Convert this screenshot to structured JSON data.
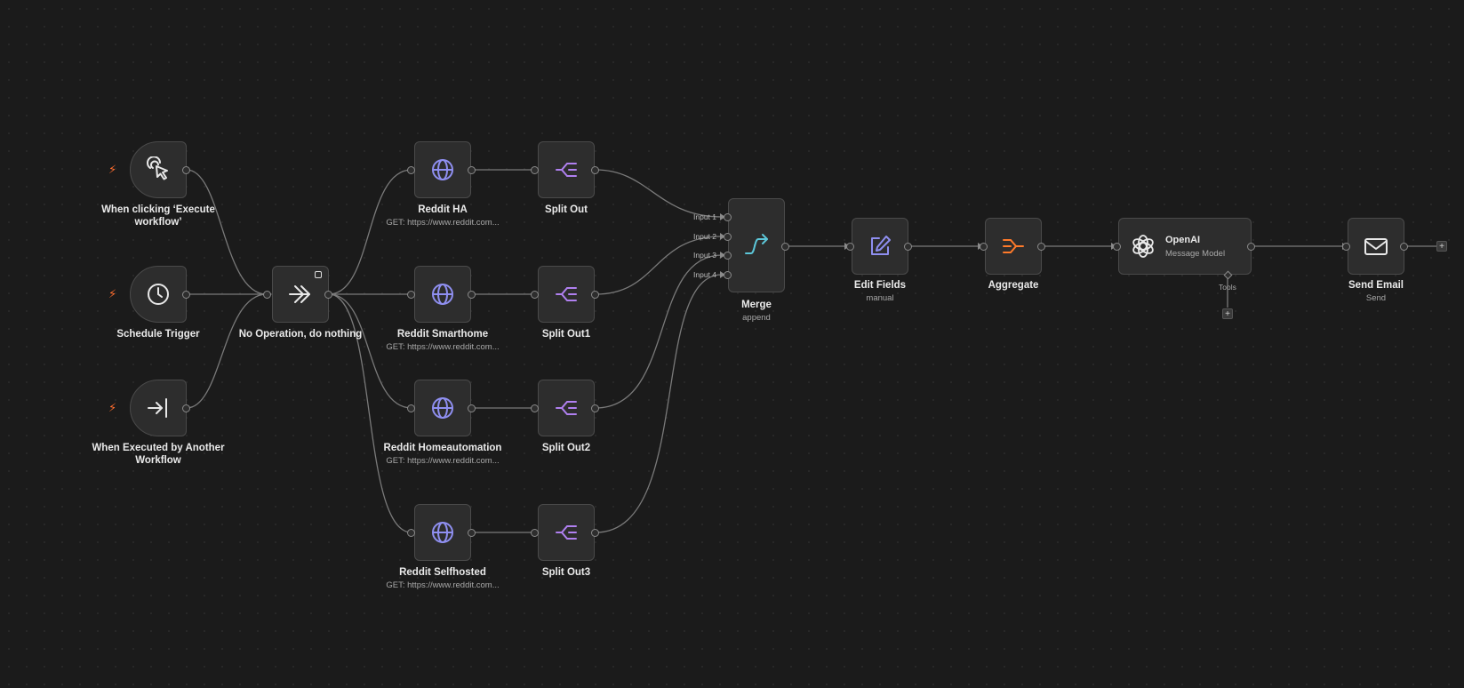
{
  "canvas": {
    "name": "workflow-canvas"
  },
  "nodes": {
    "manual_trigger": {
      "label": "When clicking ‘Execute workflow’"
    },
    "schedule_trigger": {
      "label": "Schedule Trigger"
    },
    "workflow_trigger": {
      "label": "When Executed by Another Workflow"
    },
    "noop": {
      "label": "No Operation, do nothing"
    },
    "reddit_ha": {
      "label": "Reddit HA",
      "subtitle": "GET: https://www.reddit.com..."
    },
    "reddit_smarthome": {
      "label": "Reddit Smarthome",
      "subtitle": "GET: https://www.reddit.com..."
    },
    "reddit_homeautomation": {
      "label": "Reddit Homeautomation",
      "subtitle": "GET: https://www.reddit.com..."
    },
    "reddit_selfhosted": {
      "label": "Reddit Selfhosted",
      "subtitle": "GET: https://www.reddit.com..."
    },
    "split_out": {
      "label": "Split Out"
    },
    "split_out1": {
      "label": "Split Out1"
    },
    "split_out2": {
      "label": "Split Out2"
    },
    "split_out3": {
      "label": "Split Out3"
    },
    "merge": {
      "label": "Merge",
      "subtitle": "append",
      "inputs": [
        "Input 1",
        "Input 2",
        "Input 3",
        "Input 4"
      ]
    },
    "edit_fields": {
      "label": "Edit Fields",
      "subtitle": "manual"
    },
    "aggregate": {
      "label": "Aggregate"
    },
    "openai": {
      "title": "OpenAI",
      "subtitle": "Message Model",
      "tools_label": "Tools"
    },
    "send_email": {
      "label": "Send Email",
      "subtitle": "Send"
    }
  },
  "icons": {
    "trigger_bolt": "⚡",
    "add": "+"
  },
  "colors": {
    "background": "#1b1b1b",
    "node_bg": "#2d2d2d",
    "node_border": "#4a4a4a",
    "wire": "#7a7a7a",
    "bolt": "#ff6d2e",
    "http_icon": "#8f8ff0",
    "split_icon": "#b080f0",
    "merge_icon": "#5cc6d8",
    "edit_icon": "#8f8ff0",
    "aggregate_icon": "#ff7a2a"
  }
}
